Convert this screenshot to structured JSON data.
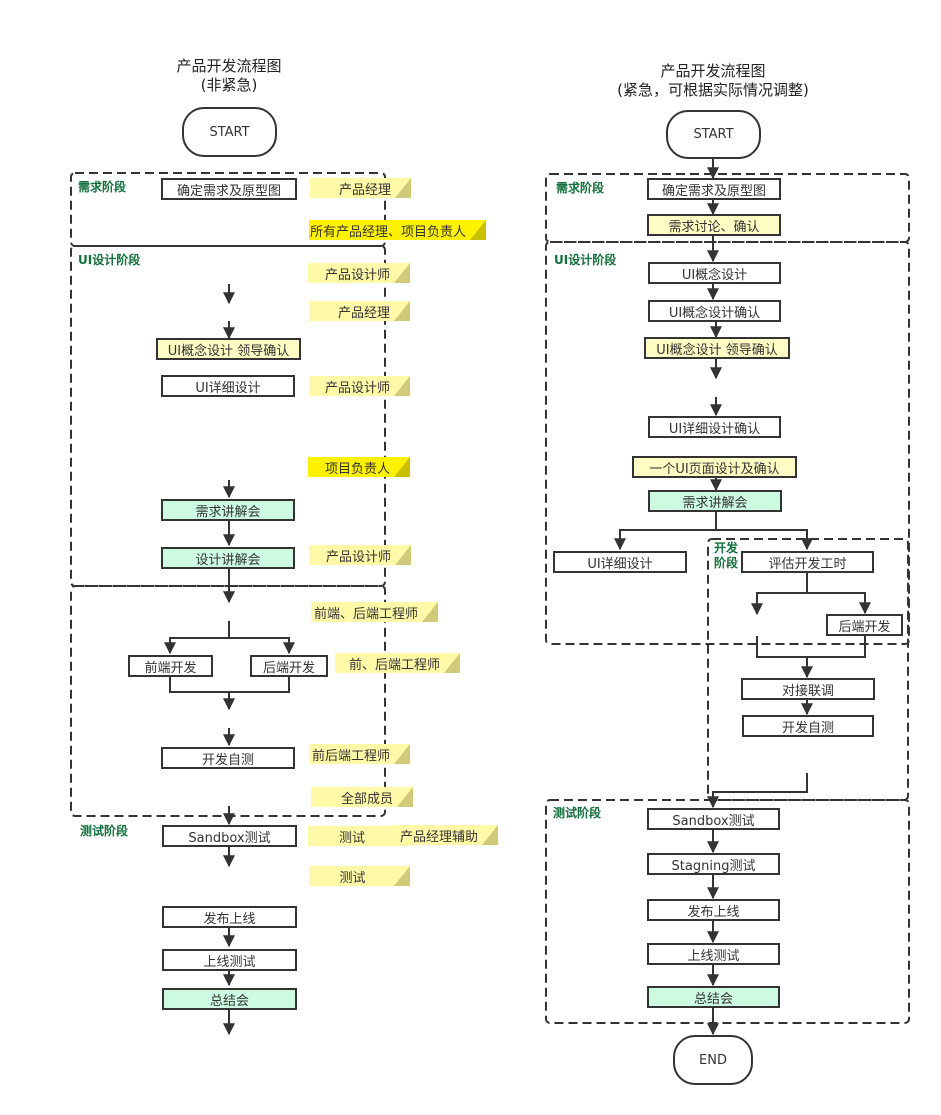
{
  "left": {
    "title": "产品开发流程图",
    "subtitle": "(非紧急)",
    "start": "START",
    "phases": {
      "requirements": "需求阶段",
      "ui_design": "UI设计阶段",
      "testing": "测试阶段"
    },
    "nodes": {
      "confirm_req": "确定需求及原型图",
      "ui_concept_leader": "UI概念设计 领导确认",
      "ui_detail": "UI详细设计",
      "req_briefing": "需求讲解会",
      "design_briefing": "设计讲解会",
      "frontend_dev": "前端开发",
      "backend_dev": "后端开发",
      "dev_selftest": "开发自测",
      "sandbox_test": "Sandbox测试",
      "release": "发布上线",
      "online_test": "上线测试",
      "summary": "总结会"
    },
    "notes": [
      {
        "text": "产品经理",
        "style": "light"
      },
      {
        "text": "所有产品经理、项目负责人",
        "style": "bright"
      },
      {
        "text": "产品设计师",
        "style": "light"
      },
      {
        "text": "产品经理",
        "style": "light"
      },
      {
        "text": "产品设计师",
        "style": "light"
      },
      {
        "text": "项目负责人",
        "style": "bright"
      },
      {
        "text": "产品设计师",
        "style": "light"
      },
      {
        "text": "前端、后端工程师",
        "style": "light"
      },
      {
        "text": "前、后端工程师",
        "style": "light"
      },
      {
        "text": "前后端工程师",
        "style": "light"
      },
      {
        "text": "全部成员",
        "style": "light"
      },
      {
        "text": "测试",
        "style": "light"
      },
      {
        "text": "产品经理辅助",
        "style": "light"
      },
      {
        "text": "测试",
        "style": "light"
      }
    ]
  },
  "right": {
    "title": "产品开发流程图",
    "subtitle": "(紧急，可根据实际情况调整)",
    "start": "START",
    "end": "END",
    "phases": {
      "requirements": "需求阶段",
      "ui_design": "UI设计阶段",
      "development": "开发阶段",
      "development_line1": "开发",
      "development_line2": "阶段",
      "testing": "测试阶段"
    },
    "nodes": {
      "confirm_req": "确定需求及原型图",
      "req_discuss": "需求讨论、确认",
      "ui_concept": "UI概念设计",
      "ui_concept_confirm": "UI概念设计确认",
      "ui_concept_leader": "UI概念设计 领导确认",
      "ui_detail_confirm": "UI详细设计确认",
      "one_page_design": "一个UI页面设计及确认",
      "req_briefing": "需求讲解会",
      "ui_detail": "UI详细设计",
      "estimate_hours": "评估开发工时",
      "backend_dev": "后端开发",
      "integration": "对接联调",
      "dev_selftest": "开发自测",
      "sandbox_test": "Sandbox测试",
      "staging_test": "Stagning测试",
      "release": "发布上线",
      "online_test": "上线测试",
      "summary": "总结会"
    }
  },
  "colors": {
    "line": "#333333",
    "phase_label": "#13703c",
    "node_yellow": "#fffdc4",
    "node_green": "#ccfbe2",
    "note_light": "#fff9a8",
    "note_bright": "#fff200"
  }
}
